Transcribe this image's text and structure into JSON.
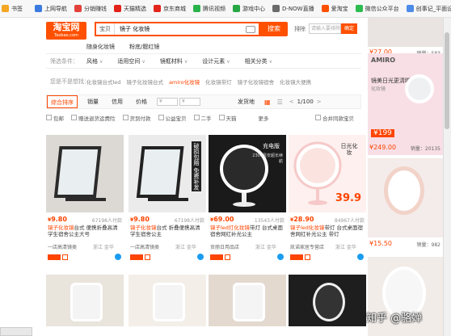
{
  "bookmarks": [
    {
      "label": "书签",
      "color": "#f5a623"
    },
    {
      "label": "上网导航",
      "color": "#3b7ae0"
    },
    {
      "label": "分销赚钱",
      "color": "#e2423b"
    },
    {
      "label": "天猫精选",
      "color": "#e2231a"
    },
    {
      "label": "京东商城",
      "color": "#e1251b"
    },
    {
      "label": "腾讯视频",
      "color": "#2ab24b"
    },
    {
      "label": "游戏中心",
      "color": "#27a745"
    },
    {
      "label": "D-NOW直播",
      "color": "#6b6b6b"
    },
    {
      "label": "爱淘宝",
      "color": "#ff5000"
    },
    {
      "label": "微信公众平台",
      "color": "#2dbc4f"
    },
    {
      "label": "创事记_平面设计",
      "color": "#4c8be8"
    }
  ],
  "logo": {
    "main": "淘宝网",
    "sub": "Taobao.com"
  },
  "search": {
    "scope": "宝贝",
    "query": "镜子 化妆镜",
    "button": "搜索",
    "within_label": "排除",
    "within_placeholder": "请输入要排除的词",
    "ok": "确定"
  },
  "filters": {
    "brand_row": {
      "label": "",
      "items": [
        "随身化妆镜",
        "粉底/腮红镜"
      ]
    },
    "criteria_row": {
      "label": "筛选条件：",
      "items": [
        "风格",
        "适用空间",
        "镜框材料",
        "设计元素",
        "相关分类"
      ]
    },
    "guess_row": {
      "label": "您是不是想找：",
      "items": [
        "化妆镜台式led",
        "镜子化妆镜台式",
        "amiro化妆镜",
        "化妆镜带灯",
        "镜子化妆镜宿舍",
        "化妆镜大便携"
      ],
      "highlight_index": 2
    }
  },
  "sort": {
    "items": [
      "综合排序",
      "销量",
      "信用",
      "价格",
      "¥",
      "¥"
    ],
    "shipping": "发货地",
    "page": "1/100",
    "checks": [
      "包邮",
      "赠送退货运费险",
      "货到付款",
      "公益宝贝",
      "二手",
      "天猫"
    ],
    "more": "更多",
    "merge": "合并同款宝贝"
  },
  "products": [
    {
      "price": "9.80",
      "buyers": "67198人付款",
      "title_hl": "镜子化妆镜",
      "title": "台式 便携折叠高清学生宿舍公主大号",
      "shop": "一店高清镜类",
      "loc": "浙江 金华",
      "bg": "#dcd9d4",
      "frame": "#2b2b2b"
    },
    {
      "price": "9.80",
      "buyers": "67198人付款",
      "title_hl": "镜子化妆镜",
      "title": "台式 折叠便携高清学生宿舍公主",
      "shop": "一店高清镜类",
      "loc": "浙江 金华",
      "bg": "#ebebeb",
      "frame": "#222",
      "badge": "破损包赔 免费补发"
    },
    {
      "price": "69.00",
      "buyers": "13543人付款",
      "title_hl": "镜子led灯化妆镜",
      "title": "带灯 台式桌面宿舍网红补光公主",
      "shop": "贡丽日用品店",
      "loc": "浙江 金华",
      "bg": "#1a1a1a",
      "frame": "#fff",
      "badge": "充电版",
      "sub": "2300毫安超长续航"
    },
    {
      "price": "28.90",
      "buyers": "84967人付款",
      "title_hl": "镜子led化妆镜",
      "title": "带灯 台式桌面宿舍网红补光公主 带灯",
      "shop": "凯诺家居专营店",
      "loc": "浙江 金华",
      "bg": "#fdf0ee",
      "frame": "#f6c9c9",
      "badge": "日光化妆",
      "badge_price": "39.9"
    }
  ],
  "sidebar": [
    {
      "price": "27.00",
      "sold": "销量：583"
    },
    {
      "brand": "AMIRO",
      "headline": "镜美日光更清晰",
      "sub": "化妆镜",
      "promo": "199",
      "price": "249.00",
      "sold": "销量：20135"
    },
    {
      "price": "15.50",
      "sold": "销量：982"
    }
  ],
  "watermark": "知乎 @骆婵",
  "colors": {
    "accent": "#ff5000",
    "price": "#ff4400"
  }
}
